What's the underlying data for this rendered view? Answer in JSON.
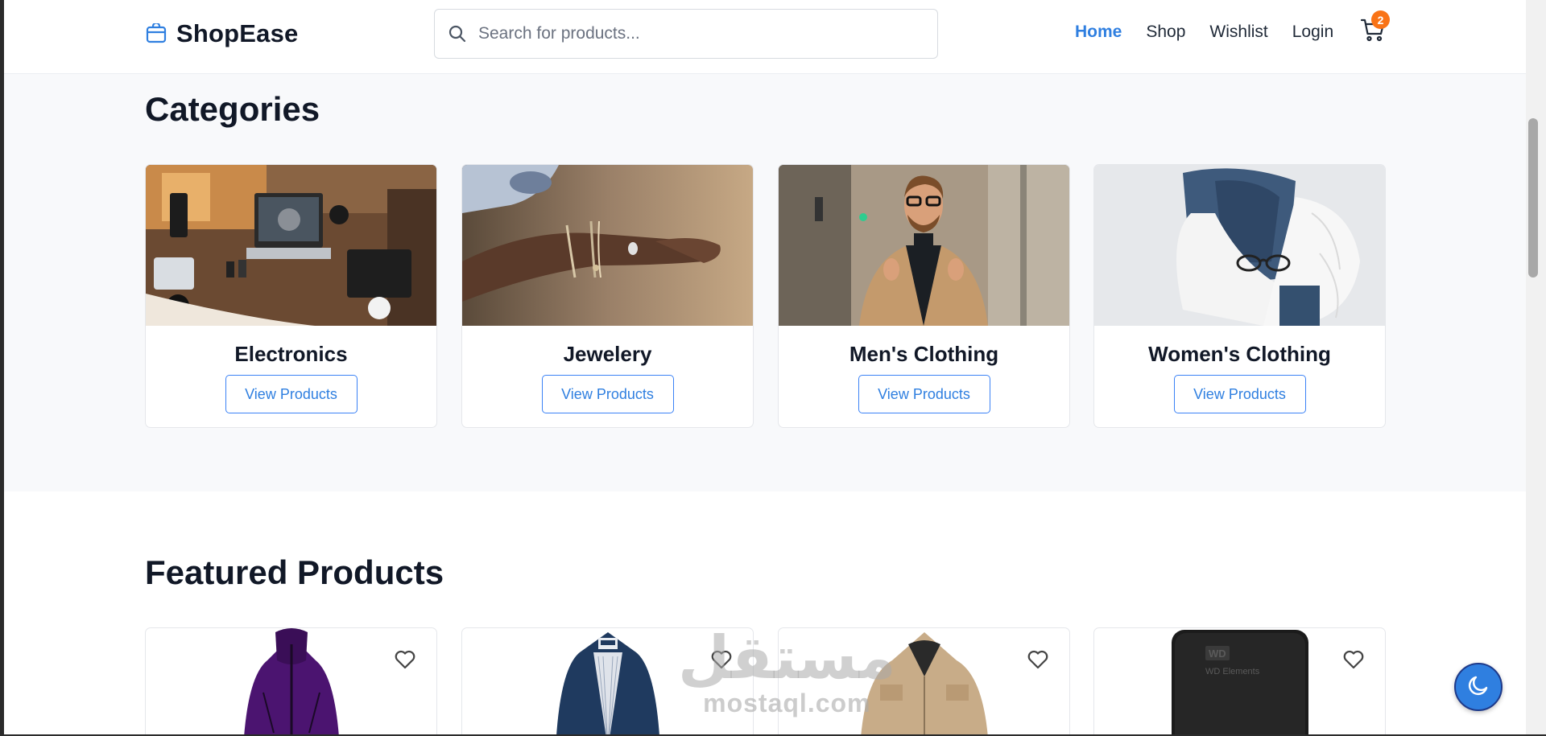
{
  "brand": {
    "name": "ShopEase",
    "accent": "#2f7fe0"
  },
  "search": {
    "placeholder": "Search for products..."
  },
  "nav": {
    "items": [
      {
        "label": "Home",
        "active": true
      },
      {
        "label": "Shop",
        "active": false
      },
      {
        "label": "Wishlist",
        "active": false
      },
      {
        "label": "Login",
        "active": false
      }
    ],
    "cart_count": "2"
  },
  "categories": {
    "title": "Categories",
    "items": [
      {
        "name": "Electronics",
        "button": "View Products",
        "image": "desk-electronics-photo"
      },
      {
        "name": "Jewelery",
        "button": "View Products",
        "image": "bracelet-photo"
      },
      {
        "name": "Men's Clothing",
        "button": "View Products",
        "image": "man-coat-photo"
      },
      {
        "name": "Women's Clothing",
        "button": "View Products",
        "image": "folded-clothes-photo"
      }
    ]
  },
  "featured": {
    "title": "Featured Products",
    "items": [
      {
        "image": "purple-jacket"
      },
      {
        "image": "navy-jacket"
      },
      {
        "image": "khaki-jacket"
      },
      {
        "image": "wd-elements-hard-drive",
        "label": "WD Elements"
      }
    ]
  },
  "watermark": {
    "arabic": "مستقل",
    "latin": "mostaql.com"
  },
  "theme_toggle": {
    "icon": "moon-icon"
  }
}
